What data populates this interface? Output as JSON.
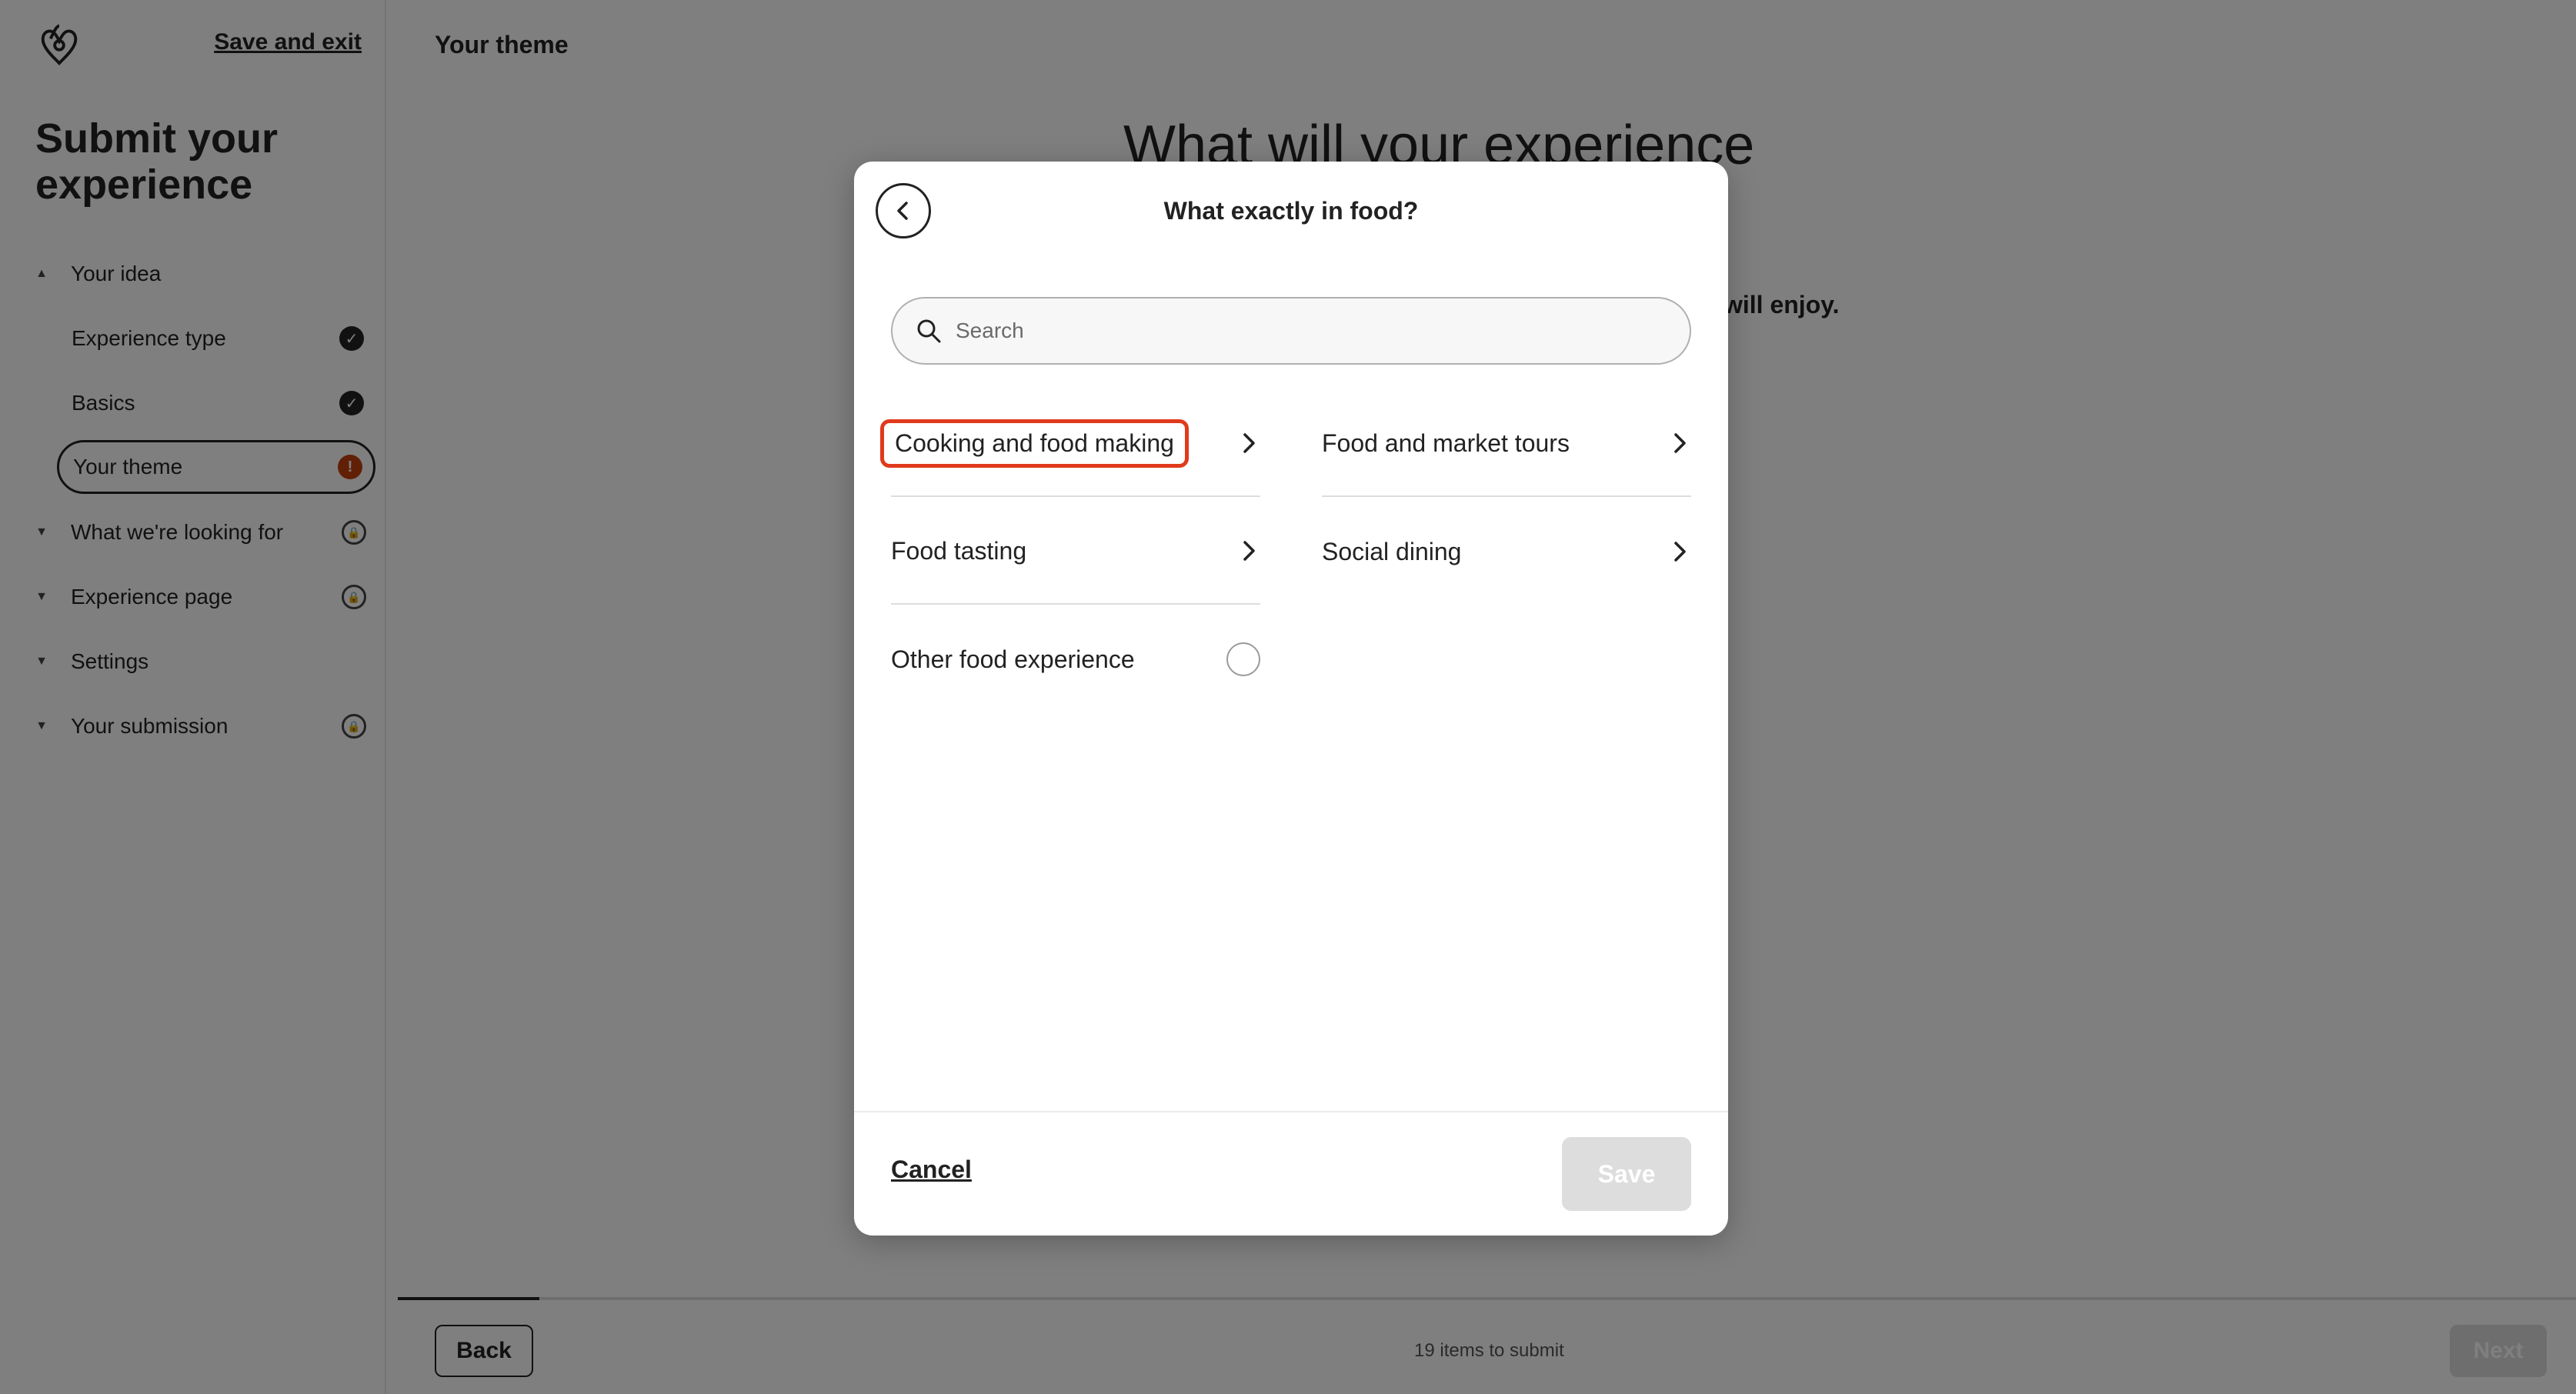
{
  "sidebar": {
    "save_exit": "Save and exit",
    "title": "Submit your experience",
    "section_idea": "Your idea",
    "items": [
      {
        "label": "Experience type",
        "status": "✓"
      },
      {
        "label": "Basics",
        "status": "✓"
      },
      {
        "label": "Your theme",
        "status": "!"
      }
    ],
    "sections": [
      {
        "label": "What we're looking for",
        "icon": "lock-icon"
      },
      {
        "label": "Experience page",
        "icon": "lock-icon"
      },
      {
        "label": "Settings",
        "icon": ""
      },
      {
        "label": "Your submission",
        "icon": "lock-icon"
      }
    ]
  },
  "main": {
    "breadcrumb": "Your theme",
    "heading": "What will your experience",
    "subtext": "will enjoy.",
    "back_label": "Back",
    "items_left": "19 items to submit",
    "next_label": "Next",
    "progress_fraction": 0.065
  },
  "modal": {
    "title": "What exactly in food?",
    "search_placeholder": "Search",
    "options": [
      {
        "label": "Cooking and food making",
        "control": "chevron-right-icon",
        "highlighted": true
      },
      {
        "label": "Food and market tours",
        "control": "chevron-right-icon"
      },
      {
        "label": "Food tasting",
        "control": "chevron-right-icon"
      },
      {
        "label": "Social dining",
        "control": "chevron-right-icon"
      },
      {
        "label": "Other food experience",
        "control": "radio"
      }
    ],
    "cancel_label": "Cancel",
    "save_label": "Save"
  },
  "colors": {
    "highlight": "#e03a1c",
    "warning": "#c2410c",
    "overlay": "rgba(0,0,0,0.5)"
  }
}
